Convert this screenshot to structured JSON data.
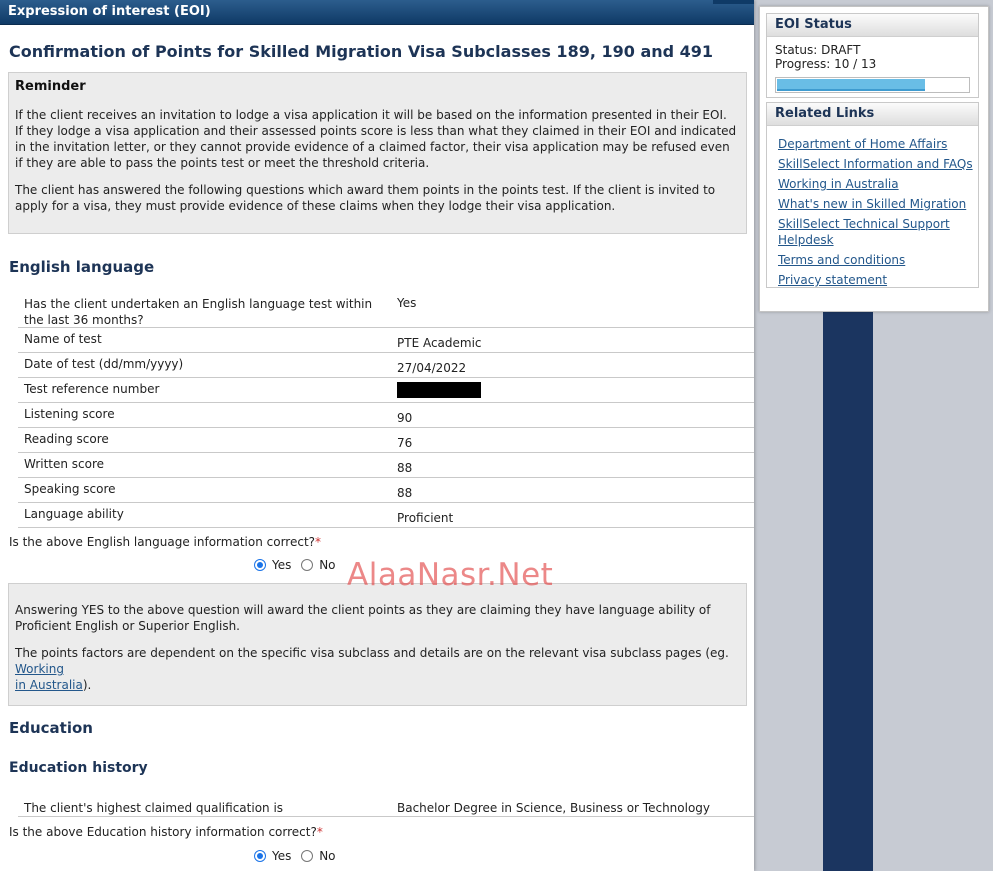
{
  "window": {
    "title": "Expression of interest (EOI)"
  },
  "page": {
    "heading": "Confirmation of Points for Skilled Migration Visa Subclasses 189, 190 and 491",
    "reminder": {
      "title": "Reminder",
      "p1": "If the client receives an invitation to lodge a visa application it will be based on the information presented in their EOI. If they lodge a visa application and their assessed points score is less than what they claimed in their EOI and indicated in the invitation letter, or they cannot provide evidence of a claimed factor, their visa application may be refused even if they are able to pass the points test or meet the threshold criteria.",
      "p2": "The client has answered the following questions which award them points in the points test. If the client is invited to apply for a visa, they must provide evidence of these claims when they lodge their visa application."
    }
  },
  "english": {
    "heading": "English language",
    "rows": [
      {
        "label": "Has the client undertaken an English language test within the last 36 months?",
        "value": "Yes"
      },
      {
        "label": "Name of test",
        "value": "PTE Academic"
      },
      {
        "label": "Date of test (dd/mm/yyyy)",
        "value": "27/04/2022"
      },
      {
        "label": "Test reference number",
        "value": ""
      },
      {
        "label": "Listening score",
        "value": "90"
      },
      {
        "label": "Reading score",
        "value": "76"
      },
      {
        "label": "Written score",
        "value": "88"
      },
      {
        "label": "Speaking score",
        "value": "88"
      },
      {
        "label": "Language ability",
        "value": "Proficient"
      }
    ],
    "question": "Is the above English language information correct?",
    "required_mark": "*",
    "yes_label": "Yes",
    "no_label": "No",
    "selected": "Yes",
    "info_p1": "Answering YES to the above question will award the client points as they are claiming they have language ability of Proficient English or Superior English.",
    "info_p2_prefix": "The points factors are dependent on the specific visa subclass and details are on the relevant visa subclass pages (eg. ",
    "info_link_1": "Working",
    "info_link_2": "in Australia",
    "info_p2_suffix": ")."
  },
  "education": {
    "heading": "Education",
    "subheading": "Education history",
    "row": {
      "label": "The client's highest claimed qualification is",
      "value": "Bachelor Degree in Science, Business or Technology"
    },
    "question": "Is the above Education history information correct?",
    "required_mark": "*",
    "yes_label": "Yes",
    "no_label": "No",
    "selected": "Yes"
  },
  "watermark": "AlaaNasr.Net",
  "eoi_status": {
    "title": "EOI Status",
    "status_line": "Status: DRAFT",
    "progress_line": "Progress: 10 / 13",
    "progress_fraction": 0.769
  },
  "related_links": {
    "title": "Related Links",
    "items": [
      "Department of Home Affairs",
      "SkillSelect Information and FAQs",
      "Working in Australia",
      "What's new in Skilled Migration",
      "SkillSelect Technical Support Helpdesk",
      "Terms and conditions",
      "Privacy statement"
    ]
  },
  "colors": {
    "header_navy": "#0f3a66",
    "heading_text": "#1d3456",
    "link": "#23578b",
    "progress_fill": "#69bde6",
    "required": "#cc3333"
  }
}
